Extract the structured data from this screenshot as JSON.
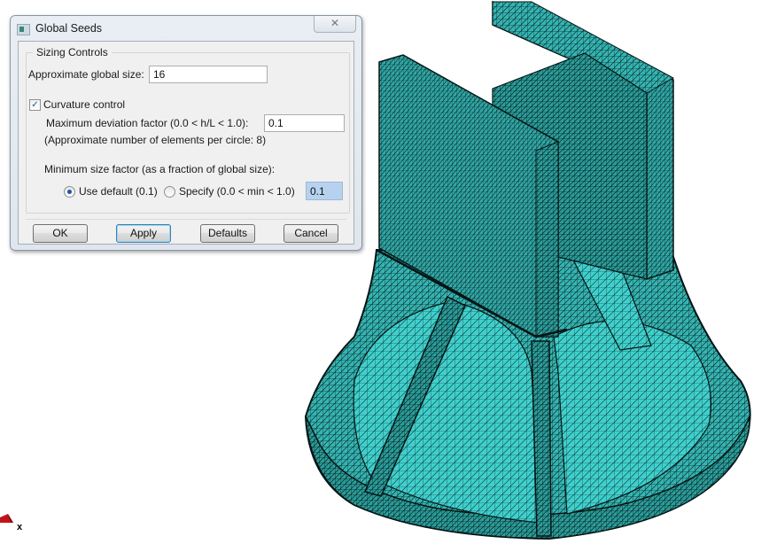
{
  "dialog": {
    "title": "Global Seeds",
    "close_glyph": "✕",
    "group_title": "Sizing Controls",
    "global_size_label": "Approximate global size:",
    "global_size_value": "16",
    "curvature_checkbox": {
      "label": "Curvature control",
      "checked": true,
      "glyph": "✓"
    },
    "max_deviation_label": "Maximum deviation factor (0.0 < h/L < 1.0):",
    "max_deviation_value": "0.1",
    "elements_per_circle_note": "(Approximate number of elements per circle: 8)",
    "min_size_label": "Minimum size factor (as a fraction of global size):",
    "min_size_options": [
      {
        "label": "Use default (0.1)",
        "selected": true
      },
      {
        "label": "Specify (0.0 < min < 1.0)",
        "selected": false
      }
    ],
    "min_size_value": "0.1",
    "buttons": {
      "ok": "OK",
      "apply": "Apply",
      "defaults": "Defaults",
      "cancel": "Cancel"
    }
  },
  "viewport": {
    "model": "meshed part (triangular elements)",
    "mesh_color": "#33b3b0",
    "edge_color": "#0a1a1a",
    "triad_axis_label": "x",
    "triad_color": "#c0141c"
  }
}
